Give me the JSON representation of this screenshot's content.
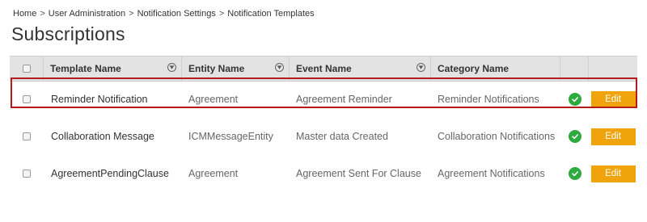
{
  "breadcrumb": {
    "items": [
      "Home",
      "User Administration",
      "Notification Settings",
      "Notification Templates"
    ],
    "separator": ">"
  },
  "page": {
    "title": "Subscriptions"
  },
  "table": {
    "headers": {
      "template_name": "Template Name",
      "entity_name": "Entity Name",
      "event_name": "Event Name",
      "category_name": "Category Name"
    },
    "edit_label": "Edit",
    "rows": [
      {
        "template_name": "Reminder Notification",
        "entity_name": "Agreement",
        "event_name": "Agreement Reminder",
        "category_name": "Reminder Notifications",
        "status": "active",
        "highlighted": true
      },
      {
        "template_name": "Collaboration Message",
        "entity_name": "ICMMessageEntity",
        "event_name": "Master data Created",
        "category_name": "Collaboration Notifications",
        "status": "active",
        "highlighted": false
      },
      {
        "template_name": "AgreementPendingClause",
        "entity_name": "Agreement",
        "event_name": "Agreement Sent For Clause",
        "category_name": "Agreement Notifications",
        "status": "active",
        "highlighted": false
      }
    ]
  },
  "colors": {
    "edit_button": "#f0a30a",
    "status_active": "#2eaa3f",
    "highlight_border": "#b21c1c",
    "header_bg": "#e3e3e3"
  },
  "icons": {
    "filter": "filter-icon",
    "status": "check-circle-icon"
  }
}
